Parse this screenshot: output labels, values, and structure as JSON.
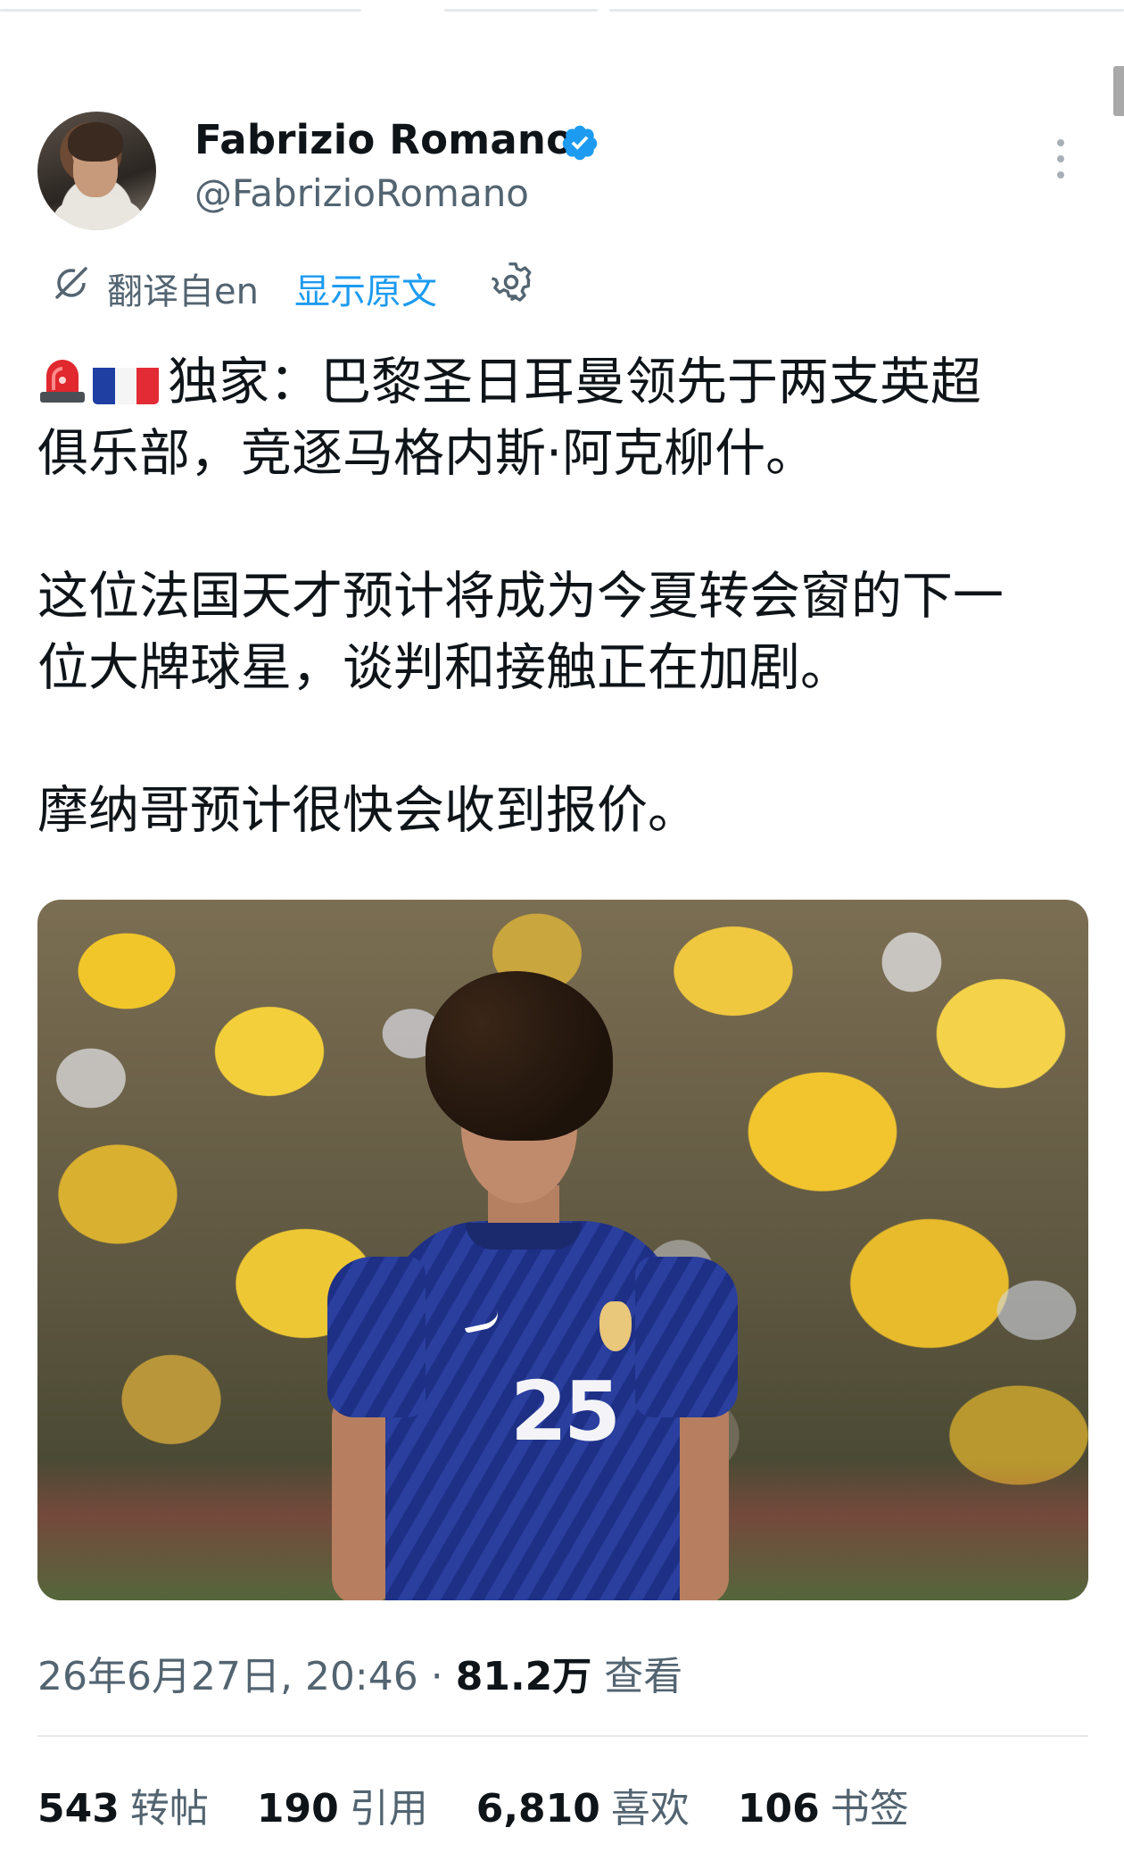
{
  "author": {
    "name": "Fabrizio Romano",
    "handle": "@FabrizioRomano",
    "verified": true,
    "verified_color": "#1d9bf0"
  },
  "translation": {
    "translated_from": "翻译自en",
    "show_original": "显示原文"
  },
  "tweet": {
    "line1": "独家：巴黎圣日耳曼领先于两支英超",
    "line2": "俱乐部，竞逐马格内斯·阿克柳什。",
    "line3": "这位法国天才预计将成为今夏转会窗的下一",
    "line4": "位大牌球星，谈判和接触正在加剧。",
    "line5": "摩纳哥预计很快会收到报价。",
    "emoji_icons": [
      "siren-icon",
      "france-flag-icon"
    ]
  },
  "photo": {
    "jersey_number": "25"
  },
  "meta": {
    "timestamp": "26年6月27日, 20:46",
    "separator": " · ",
    "views_count": "81.2万",
    "views_label": "查看"
  },
  "stats": {
    "reposts_count": "543",
    "reposts_label": "转帖",
    "quotes_count": "190",
    "quotes_label": "引用",
    "likes_count": "6,810",
    "likes_label": "喜欢",
    "bookmarks_count": "106",
    "bookmarks_label": "书签"
  },
  "colors": {
    "link": "#1d9bf0",
    "secondary_text": "#536471",
    "primary_text": "#0f1419",
    "divider": "#e6e9ec"
  }
}
